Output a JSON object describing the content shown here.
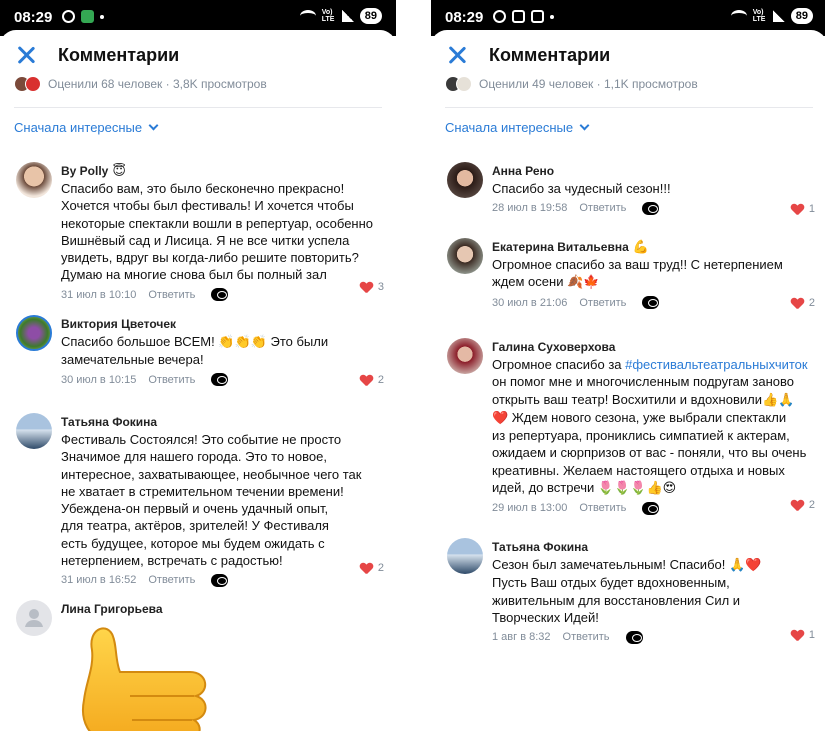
{
  "left": {
    "status": {
      "time": "08:29",
      "battery": "89",
      "network": "Vo)\nLTE"
    },
    "header": {
      "title": "Комментарии"
    },
    "ratings": {
      "text": "Оценили 68 человек · 3,8K просмотров"
    },
    "sort": {
      "label": "Сначала интересные"
    },
    "comments": [
      {
        "author": "By Polly",
        "badge": "😇",
        "text": "Спасибо вам, это было бесконечно прекрасно!\nХочется чтобы был фестиваль! И хочется чтобы\nнекоторые спектакли вошли в репертуар, особенно\nВишнёвый сад и Лисица. Я не все читки успела\nувидеть, вдруг вы когда-либо решите повторить?\nДумаю на многие снова был бы полный зал",
        "date": "31 июл в 10:10",
        "reply": "Ответить",
        "likes": "3"
      },
      {
        "author": "Виктория Цветочек",
        "text_prefix": "Спасибо большое ВСЕМ! ",
        "emoji": "👏👏👏",
        "text_suffix": " Это были\nзамечательные вечера!",
        "date": "30 июл в 10:15",
        "reply": "Ответить",
        "likes": "2"
      },
      {
        "author": "Татьяна Фокина",
        "text": "Фестиваль Состоялся! Это событие не просто\nЗначимое для нашего города. Это то новое,\nинтересное, захватывающее, необычное чего так\nне хватает в стремительном течении времени!\nУбеждена-он первый и очень удачный опыт,\nдля театра, актёров, зрителей! У Фестиваля\nесть будущее, которое мы будем ожидать с\nнетерпением, встречать с радостью!",
        "date": "31 июл в 16:52",
        "reply": "Ответить",
        "likes": "2"
      },
      {
        "author": "Лина Григорьева",
        "sticker": "thumbs-up-sticker"
      }
    ]
  },
  "right": {
    "status": {
      "time": "08:29",
      "battery": "89",
      "network": "Vo)\nLTE"
    },
    "header": {
      "title": "Комментарии"
    },
    "ratings": {
      "text": "Оценили 49 человек · 1,1K просмотров"
    },
    "sort": {
      "label": "Сначала интересные"
    },
    "comments": [
      {
        "author": "Анна Рено",
        "text": "Спасибо за чудесный сезон!!!",
        "date": "28 июл в 19:58",
        "reply": "Ответить",
        "likes": "1"
      },
      {
        "author": "Екатерина Витальевна",
        "badge": "💪",
        "text": "Огромное спасибо за ваш труд!! С нетерпением\nждем осени ",
        "emoji": "🍂🍁",
        "date": "30 июл в 21:06",
        "reply": "Ответить",
        "likes": "2"
      },
      {
        "author": "Галина Суховерхова",
        "text_prefix": "Огромное спасибо за ",
        "hashtag": "#фестивальтеатральныхчиток",
        "text_mid": "\nон помог мне и многочисленным подругам заново\nоткрыть ваш театр! Восхитили и вдохновили",
        "emoji_a": "👍🙏",
        "emoji_b": "❤️",
        "text_suffix": " Ждем нового сезона, уже выбрали спектакли\nиз репертуара, прониклись симпатией к актерам,\nожидаем и сюрпризов от вас - поняли, что вы очень\nкреативны. Желаем настоящего отдыха и новых\nидей, до встречи ",
        "emoji_c": "🌷🌷🌷👍😍",
        "date": "29 июл в 13:00",
        "reply": "Ответить",
        "likes": "2"
      },
      {
        "author": "Татьяна Фокина",
        "text_prefix": "Сезон был замечатеьльным! Спасибо! ",
        "emoji": "🙏❤️",
        "text_suffix": "\nПусть Ваш отдых будет вдохновенным,\nживительным для восстановления Сил и\nТворческих Идей!",
        "date": "1 авг в 8:32",
        "reply": "Ответить",
        "likes": "1"
      }
    ]
  },
  "colors": {
    "accent": "#2a7bd6",
    "muted": "#818c99",
    "like": "#e64646"
  }
}
